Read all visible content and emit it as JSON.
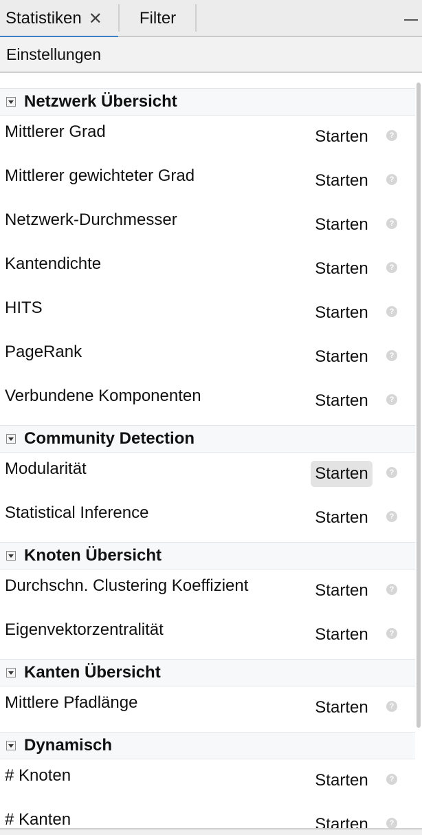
{
  "tabs": [
    {
      "label": "Statistiken",
      "close": "✕"
    },
    {
      "label": "Filter"
    }
  ],
  "toolbar": {
    "label": "Einstellungen"
  },
  "run_label": "Starten",
  "help_glyph": "?",
  "sections": [
    {
      "title": "Netzwerk Übersicht",
      "items": [
        "Mittlerer Grad",
        "Mittlerer gewichteter Grad",
        "Netzwerk-Durchmesser",
        "Kantendichte",
        "HITS",
        "PageRank",
        "Verbundene Komponenten"
      ]
    },
    {
      "title": "Community Detection",
      "items": [
        "Modularität",
        "Statistical Inference"
      ]
    },
    {
      "title": "Knoten Übersicht",
      "items": [
        "Durchschn. Clustering Koeffizient",
        "Eigenvektorzentralität"
      ]
    },
    {
      "title": "Kanten Übersicht",
      "items": [
        "Mittlere Pfadlänge"
      ]
    },
    {
      "title": "Dynamisch",
      "items": [
        "# Knoten",
        "# Kanten"
      ]
    }
  ]
}
